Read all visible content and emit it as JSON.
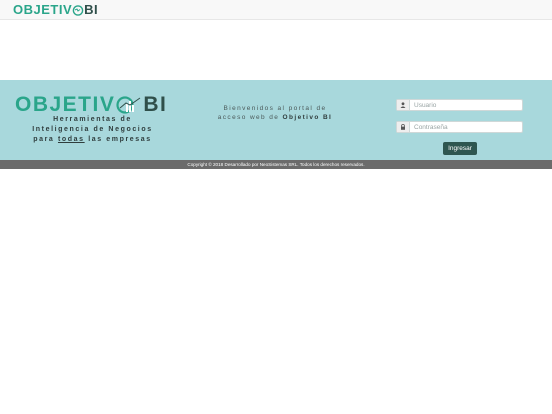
{
  "header": {
    "logo_main": "OBJETIV",
    "logo_bi": "BI"
  },
  "brand": {
    "logo_main": "OBJETIV",
    "logo_bi": "BI",
    "tagline_line1": "Herramientas de",
    "tagline_line2": "Inteligencia de Negocios",
    "tagline_pre": "para",
    "tagline_emph": "todas",
    "tagline_post": "las empresas"
  },
  "welcome": {
    "line1": "Bienvenidos al portal de",
    "line2_pre": "acceso web de",
    "line2_brand": "Objetivo BI"
  },
  "login": {
    "username_placeholder": "Usuario",
    "password_placeholder": "Contraseña",
    "submit_label": "Ingresar",
    "user_icon": "user-icon",
    "lock_icon": "lock-icon"
  },
  "footer": {
    "copyright": "Copyright © 2018 Desarrollado por NeoSistemas SRL. Todos los derechos reservados."
  },
  "colors": {
    "brand_green": "#2aa58a",
    "brand_dark": "#2f4f4a",
    "band": "#a8d8dc",
    "button": "#2e5650",
    "footer": "#6b6b6b"
  }
}
